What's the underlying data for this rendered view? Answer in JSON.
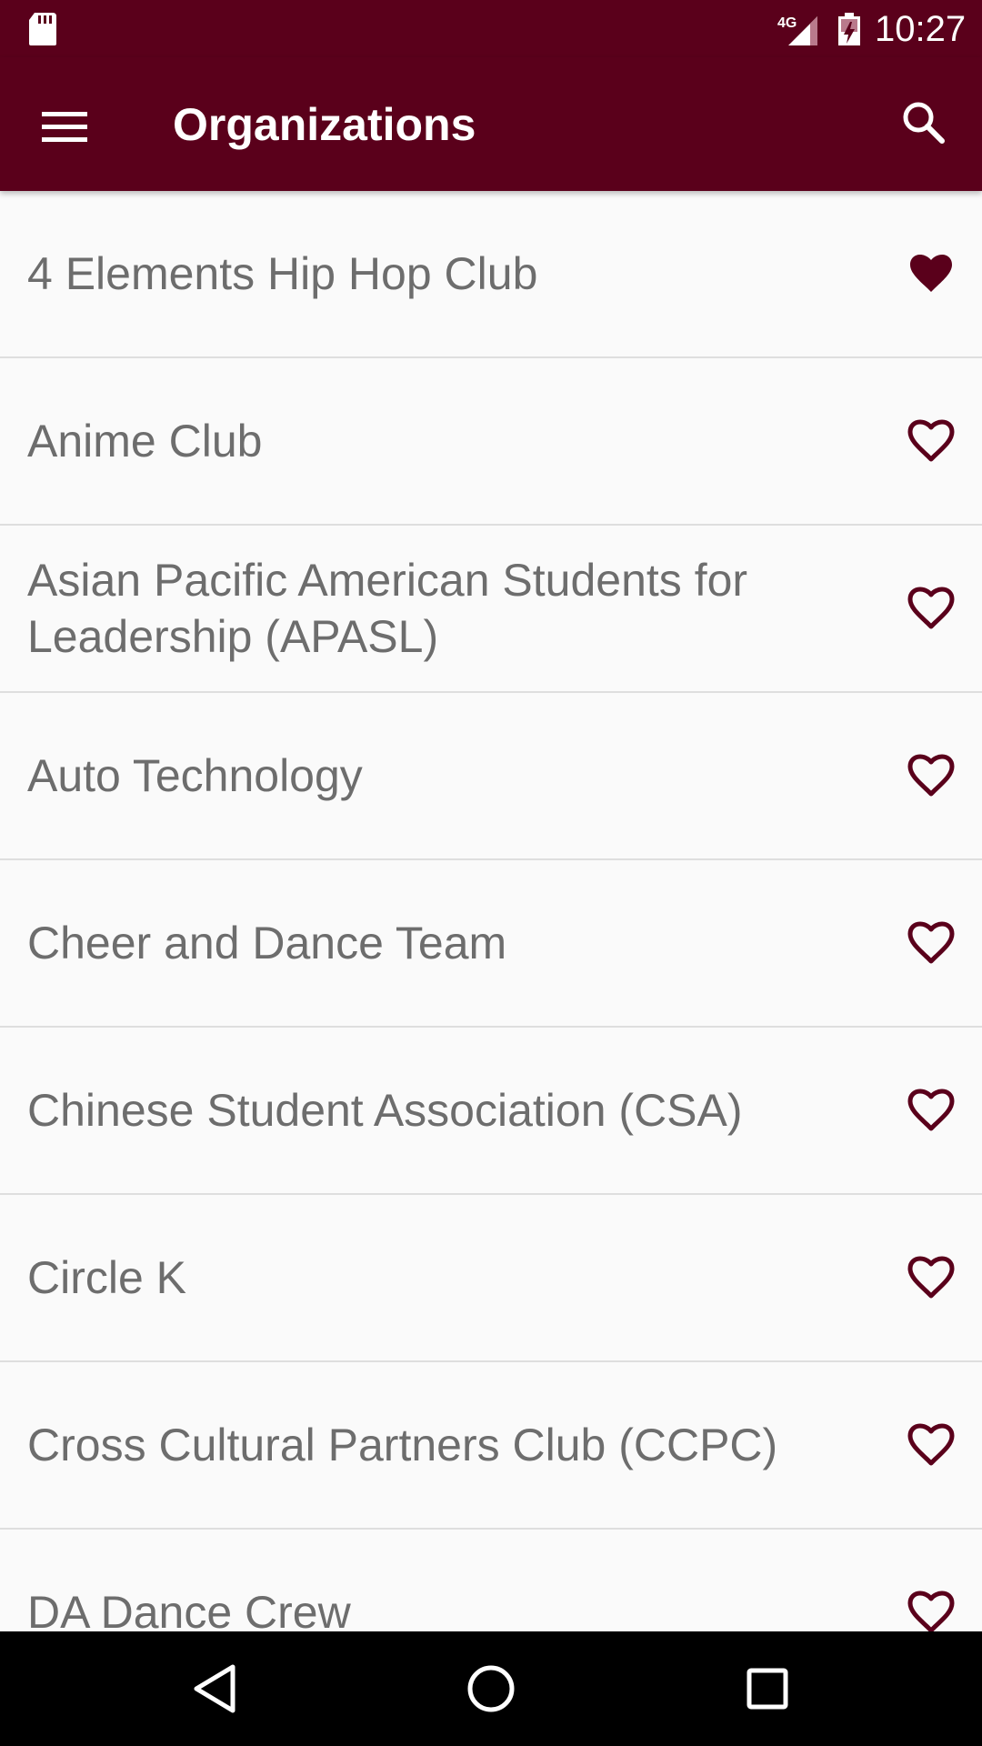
{
  "status_bar": {
    "time": "10:27",
    "network": "4G",
    "icons": [
      "sd-card-icon",
      "signal-icon",
      "battery-icon"
    ]
  },
  "toolbar": {
    "title": "Organizations",
    "menu_icon": "menu-icon",
    "search_icon": "search-icon"
  },
  "colors": {
    "primary": "#5a001b",
    "text": "#6d6d6d",
    "divider": "#dedede",
    "background": "#fafafa"
  },
  "organizations": [
    {
      "label": "4 Elements Hip Hop Club",
      "favorite": true
    },
    {
      "label": "Anime Club",
      "favorite": false
    },
    {
      "label": "Asian Pacific American Students for Leadership (APASL)",
      "favorite": false
    },
    {
      "label": "Auto Technology",
      "favorite": false
    },
    {
      "label": "Cheer and Dance Team",
      "favorite": false
    },
    {
      "label": "Chinese Student Association (CSA)",
      "favorite": false
    },
    {
      "label": "Circle K",
      "favorite": false
    },
    {
      "label": "Cross Cultural Partners Club (CCPC)",
      "favorite": false
    },
    {
      "label": "DA Dance Crew",
      "favorite": false
    }
  ],
  "nav_bar": {
    "buttons": [
      "back-icon",
      "home-icon",
      "recents-icon"
    ]
  }
}
